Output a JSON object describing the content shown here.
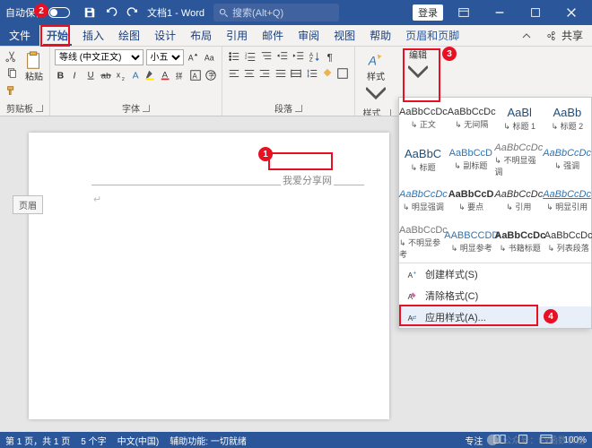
{
  "titlebar": {
    "autosave_label": "自动保存",
    "autosave_on": false,
    "doc_name": "文档1 - Word",
    "search_placeholder": "搜索(Alt+Q)",
    "login": "登录"
  },
  "tabs": {
    "file": "文件",
    "items": [
      "开始",
      "插入",
      "绘图",
      "设计",
      "布局",
      "引用",
      "邮件",
      "审阅",
      "视图",
      "帮助"
    ],
    "context": "页眉和页脚",
    "share": "共享"
  },
  "ribbon": {
    "clipboard": {
      "paste": "粘贴",
      "label": "剪贴板"
    },
    "font": {
      "name": "等线 (中文正文)",
      "size": "小五",
      "label": "字体"
    },
    "paragraph": {
      "label": "段落"
    },
    "styles": {
      "btn": "样式",
      "label": "样式"
    },
    "editing": {
      "btn": "编辑"
    }
  },
  "document": {
    "header_text": "我爱分享网",
    "header_tag": "页眉",
    "para_mark": "↵"
  },
  "gallery": {
    "rows": [
      [
        {
          "preview": "AaBbCcDc",
          "label": "正文",
          "cls": ""
        },
        {
          "preview": "AaBbCcDc",
          "label": "无间隔",
          "cls": ""
        },
        {
          "preview": "AaBl",
          "label": "标题 1",
          "cls": "h"
        },
        {
          "preview": "AaBb",
          "label": "标题 2",
          "cls": "h"
        }
      ],
      [
        {
          "preview": "AaBbC",
          "label": "标题",
          "cls": "h"
        },
        {
          "preview": "AaBbCcD",
          "label": "副标题",
          "cls": "blue"
        },
        {
          "preview": "AaBbCcDc",
          "label": "不明显强调",
          "cls": "ital grey"
        },
        {
          "preview": "AaBbCcDc",
          "label": "强调",
          "cls": "ital blue"
        }
      ],
      [
        {
          "preview": "AaBbCcDc",
          "label": "明显强调",
          "cls": "ital blue"
        },
        {
          "preview": "AaBbCcD",
          "label": "要点",
          "cls": "bold"
        },
        {
          "preview": "AaBbCcDc",
          "label": "引用",
          "cls": "ital"
        },
        {
          "preview": "AaBbCcDc",
          "label": "明显引用",
          "cls": "ital blue uline"
        }
      ],
      [
        {
          "preview": "AaBbCcDc",
          "label": "不明显参考",
          "cls": "grey"
        },
        {
          "preview": "AABBCCDD",
          "label": "明显参考",
          "cls": "blue"
        },
        {
          "preview": "AaBbCcDc",
          "label": "书籍标题",
          "cls": "bold"
        },
        {
          "preview": "AaBbCcDc",
          "label": "列表段落",
          "cls": ""
        }
      ]
    ],
    "actions": {
      "create": "创建样式(S)",
      "clear": "清除格式(C)",
      "apply": "应用样式(A)..."
    }
  },
  "callouts": {
    "c1": "1",
    "c2": "2",
    "c3": "3",
    "c4": "4"
  },
  "status": {
    "page": "第 1 页，共 1 页",
    "words": "5 个字",
    "lang": "中文(中国)",
    "access": "辅助功能: 一切就绪",
    "focus": "专注",
    "zoom": "100%"
  },
  "watermark": {
    "text": "公众号：Ex函数表姐",
    "id": "ID:8270707"
  }
}
